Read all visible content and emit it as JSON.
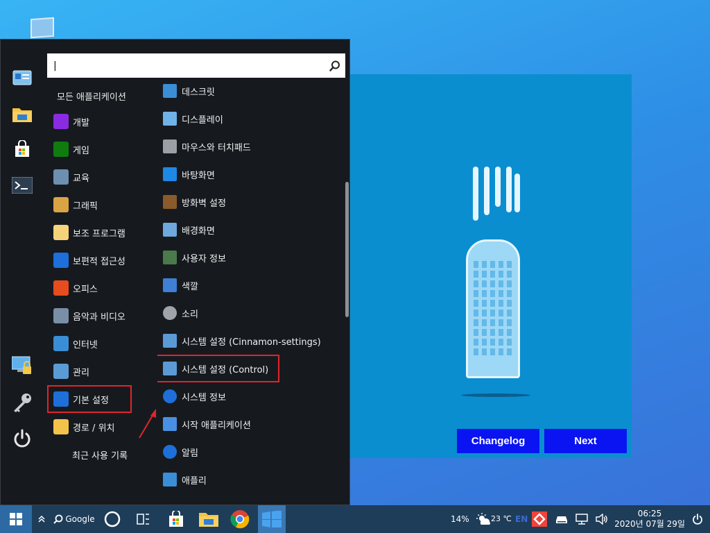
{
  "start_menu": {
    "search": {
      "value": "|",
      "placeholder": ""
    },
    "category_header": "모든 애플리케이션",
    "categories": [
      {
        "label": "개발",
        "icon": "visual-studio-icon",
        "color": "#8a2be2"
      },
      {
        "label": "게임",
        "icon": "xbox-icon",
        "color": "#107c10"
      },
      {
        "label": "교육",
        "icon": "education-icon",
        "color": "#6d8fb0"
      },
      {
        "label": "그래픽",
        "icon": "palette-icon",
        "color": "#d9a441"
      },
      {
        "label": "보조 프로그램",
        "icon": "folder-notes-icon",
        "color": "#f4d37a"
      },
      {
        "label": "보편적 접근성",
        "icon": "accessibility-icon",
        "color": "#1e6fd9"
      },
      {
        "label": "오피스",
        "icon": "office-icon",
        "color": "#e74c1e"
      },
      {
        "label": "음악과 비디오",
        "icon": "media-icon",
        "color": "#7a8fa6"
      },
      {
        "label": "인터넷",
        "icon": "globe-icon",
        "color": "#3a8ed6"
      },
      {
        "label": "관리",
        "icon": "control-panel-icon",
        "color": "#5b9bd5"
      },
      {
        "label": "기본 설정",
        "icon": "gear-icon",
        "color": "#1e6fd9"
      },
      {
        "label": "경로 / 위치",
        "icon": "folder-icon",
        "color": "#f4c34a"
      },
      {
        "label": "최근 사용 기록",
        "icon": "",
        "color": ""
      }
    ],
    "apps": [
      {
        "label": "데스크릿",
        "icon": "desklet-icon",
        "color": "#3a8ed6"
      },
      {
        "label": "디스플레이",
        "icon": "display-icon",
        "color": "#6fb3e8"
      },
      {
        "label": "마우스와 터치패드",
        "icon": "mouse-icon",
        "color": "#9aa0a6"
      },
      {
        "label": "바탕화면",
        "icon": "desktop-icon",
        "color": "#1e88e5"
      },
      {
        "label": "방화벽 설정",
        "icon": "firewall-icon",
        "color": "#8b5a2b"
      },
      {
        "label": "배경화면",
        "icon": "wallpaper-icon",
        "color": "#6fa8dc"
      },
      {
        "label": "사용자 정보",
        "icon": "user-icon",
        "color": "#4a7a4a"
      },
      {
        "label": "색깔",
        "icon": "color-icon",
        "color": "#3f7fd6"
      },
      {
        "label": "소리",
        "icon": "speaker-icon",
        "color": "#a0a4aa"
      },
      {
        "label": "시스템 설정 (Cinnamon-settings)",
        "icon": "settings-panel-icon",
        "color": "#5b9bd5"
      },
      {
        "label": "시스템 설정 (Control)",
        "icon": "settings-panel-icon",
        "color": "#5b9bd5"
      },
      {
        "label": "시스템 정보",
        "icon": "help-icon",
        "color": "#1e6fd9"
      },
      {
        "label": "시작 애플리케이션",
        "icon": "startup-icon",
        "color": "#4a90e2"
      },
      {
        "label": "알림",
        "icon": "info-icon",
        "color": "#1e6fd9"
      },
      {
        "label": "애플리",
        "icon": "apps-icon",
        "color": "#3a8ed6"
      }
    ]
  },
  "welcome": {
    "changelog_label": "Changelog",
    "next_label": "Next"
  },
  "taskbar": {
    "search_label": "Google",
    "tray": {
      "battery": "14%",
      "weather": "23 ℃",
      "lang": "EN",
      "time": "06:25",
      "date": "2020년 07월 29일"
    }
  }
}
